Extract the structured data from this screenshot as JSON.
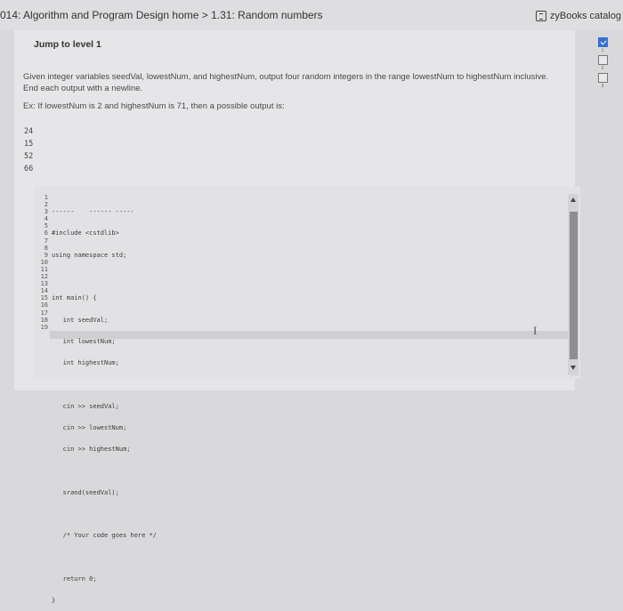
{
  "header": {
    "breadcrumb": "014: Algorithm and Program Design home > 1.31: Random numbers",
    "catalog_label": "zyBooks catalog"
  },
  "activity": {
    "jump_label": "Jump to level 1",
    "prompt": "Given integer variables seedVal, lowestNum, and highestNum, output four random integers in the range lowestNum to highestNum inclusive. End each output with a newline.",
    "example": "Ex: If lowestNum is 2 and highestNum is 71, then a possible output is:",
    "sample_output": [
      "24",
      "15",
      "52",
      "66"
    ]
  },
  "levels": [
    {
      "num": "1",
      "done": true
    },
    {
      "num": "2",
      "done": false
    },
    {
      "num": "3",
      "done": false
    }
  ],
  "editor": {
    "line_numbers": [
      "1",
      "2",
      "3",
      "4",
      "5",
      "6",
      "7",
      "8",
      "9",
      "10",
      "11",
      "12",
      "13",
      "14",
      "15",
      "16",
      "17",
      "18",
      "19"
    ],
    "lines": [
      "------    ------ -----",
      "#include <cstdlib>",
      "using namespace std;",
      "",
      "int main() {",
      "   int seedVal;",
      "   int lowestNum;",
      "   int highestNum;",
      "",
      "   cin >> seedVal;",
      "   cin >> lowestNum;",
      "   cin >> highestNum;",
      "",
      "   srand(seedVal);",
      "",
      "   /* Your code goes here */",
      "",
      "   return 0;",
      "}"
    ],
    "cursor_glyph": "I"
  },
  "colors": {
    "accent": "#3a6fd0",
    "background": "#d9d9db",
    "scroll_thumb": "#8e8e92"
  }
}
